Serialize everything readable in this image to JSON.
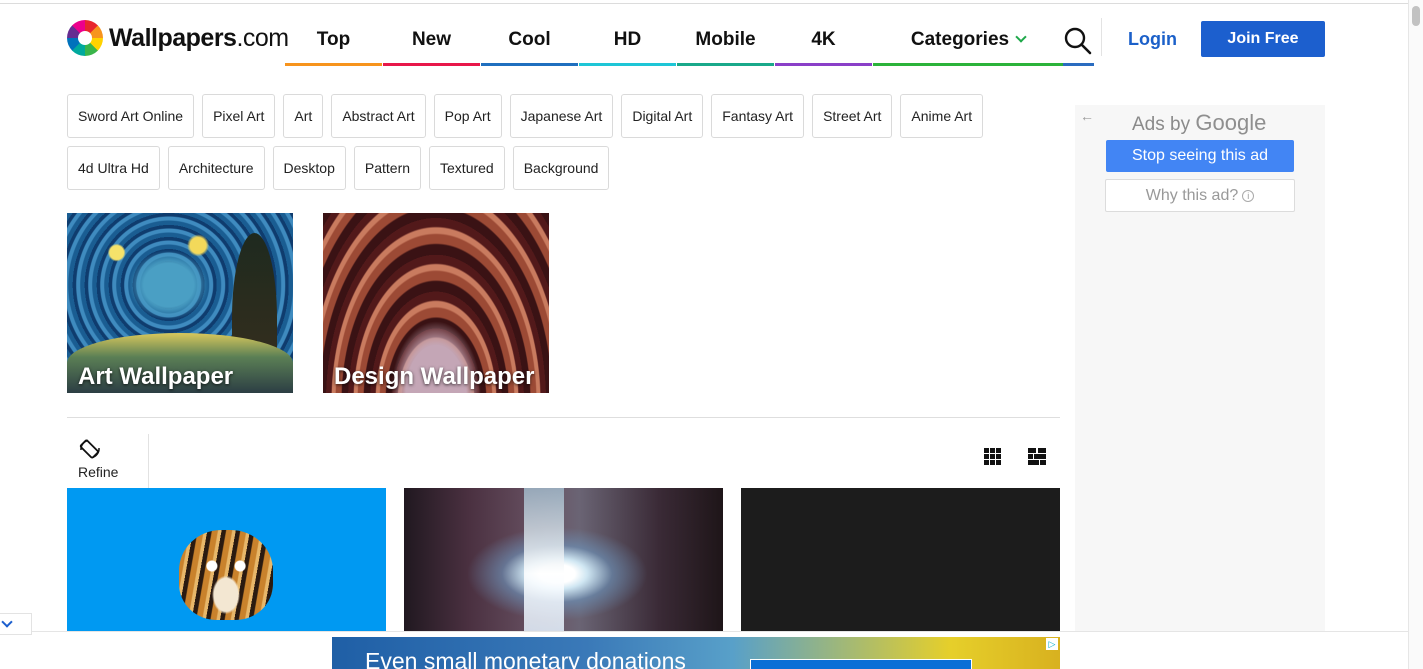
{
  "logo": {
    "name_bold": "Wallpapers",
    "name_light": ".com"
  },
  "nav": {
    "items": [
      {
        "label": "Top",
        "color": "#f7941d"
      },
      {
        "label": "New",
        "color": "#e8174a"
      },
      {
        "label": "Cool",
        "color": "#1f6fbf"
      },
      {
        "label": "HD",
        "color": "#1ec6d6"
      },
      {
        "label": "Mobile",
        "color": "#19a98a"
      },
      {
        "label": "4K",
        "color": "#8a3fc8"
      },
      {
        "label": "Categories",
        "color": "#2bb33a"
      }
    ],
    "search_icon": "search-icon",
    "search_color": "#2a6cc0",
    "login": "Login",
    "join": "Join Free"
  },
  "tags": [
    "Sword Art Online",
    "Pixel Art",
    "Art",
    "Abstract Art",
    "Pop Art",
    "Japanese Art",
    "Digital Art",
    "Fantasy Art",
    "Street Art",
    "Anime Art",
    "4d Ultra Hd",
    "Architecture",
    "Desktop",
    "Pattern",
    "Textured",
    "Background"
  ],
  "categories": [
    {
      "label": "Art Wallpaper"
    },
    {
      "label": "Design Wallpaper"
    }
  ],
  "toolbar": {
    "refine_label": "Refine",
    "refine_icon": "screen-rotation-icon",
    "grid_icon_large": "grid-3x3-icon",
    "grid_icon_wide": "grid-mosaic-icon"
  },
  "thumbnails": [
    {
      "subject": "tiger",
      "bg": "#0099f2"
    },
    {
      "subject": "tunnel-light"
    },
    {
      "subject": "dark",
      "bg": "#1c1c1c"
    }
  ],
  "ad": {
    "ads_by": "Ads by",
    "google": "Google",
    "stop": "Stop seeing this ad",
    "why": "Why this ad?",
    "info_glyph": "i",
    "back_glyph": "←"
  },
  "bottom_ad": {
    "text": "Even small monetary donations",
    "adchoices_glyph": "▷"
  }
}
